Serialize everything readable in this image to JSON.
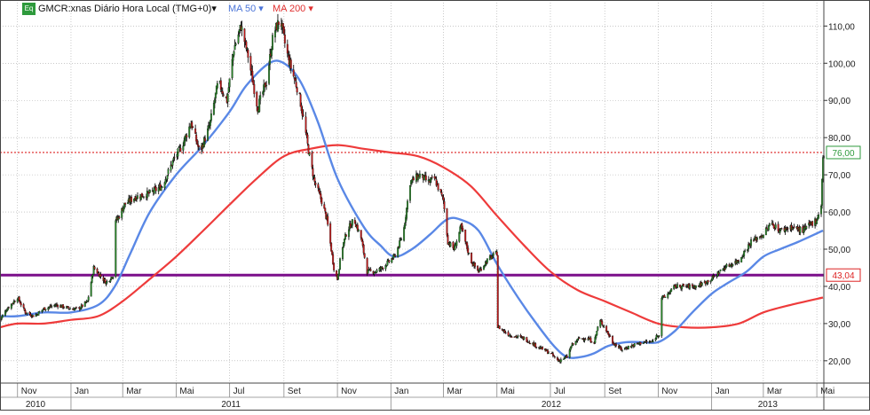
{
  "header": {
    "badge": "Eq",
    "symbol_label": "GMCR:xnas Diário Hora Local (TMG+0)",
    "ma50_label": "MA 50",
    "ma200_label": "MA 200",
    "dropdown_glyph": "▾"
  },
  "colors": {
    "price": "#111111",
    "up_candle": "#2a8a2a",
    "down_candle": "#c21a1a",
    "ma50": "#5a88e6",
    "ma200": "#ee3b3b",
    "support_line": "#7b0f8a",
    "dotted_line": "#dd2222",
    "grid": "#a8a8a8",
    "badge_green": "#2e9a3c",
    "badge_red": "#dd2222",
    "badge_purple": "#8a1a8a"
  },
  "chart_data": {
    "type": "candlestick",
    "y_axis": {
      "min": 14,
      "max": 117,
      "ticks": [
        20,
        30,
        40,
        50,
        60,
        70,
        80,
        90,
        100,
        110
      ],
      "tick_labels": [
        "20,00",
        "30,00",
        "40,00",
        "50,00",
        "60,00",
        "70,00",
        "80,00",
        "90,00",
        "100,00",
        "110,00"
      ]
    },
    "x_axis": {
      "range": [
        "2010-10-12",
        "2013-05-09"
      ],
      "month_ticks": [
        {
          "date": "2010-11-01",
          "label": "Nov"
        },
        {
          "date": "2011-01-01",
          "label": "Jan"
        },
        {
          "date": "2011-03-01",
          "label": "Mar"
        },
        {
          "date": "2011-05-01",
          "label": "Mai"
        },
        {
          "date": "2011-07-01",
          "label": "Jul"
        },
        {
          "date": "2011-09-01",
          "label": "Set"
        },
        {
          "date": "2011-11-01",
          "label": "Nov"
        },
        {
          "date": "2012-01-01",
          "label": "Jan"
        },
        {
          "date": "2012-03-01",
          "label": "Mar"
        },
        {
          "date": "2012-05-01",
          "label": "Mai"
        },
        {
          "date": "2012-07-01",
          "label": "Jul"
        },
        {
          "date": "2012-09-01",
          "label": "Set"
        },
        {
          "date": "2012-11-01",
          "label": "Nov"
        },
        {
          "date": "2013-01-01",
          "label": "Jan"
        },
        {
          "date": "2013-03-01",
          "label": "Mar"
        },
        {
          "date": "2013-05-01",
          "label": "Mai"
        }
      ],
      "year_labels": [
        {
          "label": "2010",
          "start": "2010-10-12",
          "end": "2011-01-01"
        },
        {
          "label": "2011",
          "start": "2011-01-01",
          "end": "2012-01-01"
        },
        {
          "label": "2012",
          "start": "2012-01-01",
          "end": "2013-01-01"
        },
        {
          "label": "2013",
          "start": "2013-01-01",
          "end": "2013-05-09"
        }
      ]
    },
    "price_path": [
      [
        "2010-10-12",
        31
      ],
      [
        "2010-10-20",
        34
      ],
      [
        "2010-11-01",
        37
      ],
      [
        "2010-11-10",
        33
      ],
      [
        "2010-11-20",
        32
      ],
      [
        "2010-12-01",
        34
      ],
      [
        "2010-12-15",
        35
      ],
      [
        "2011-01-01",
        34
      ],
      [
        "2011-01-10",
        34
      ],
      [
        "2011-01-20",
        36
      ],
      [
        "2011-01-27",
        45
      ],
      [
        "2011-02-03",
        43
      ],
      [
        "2011-02-10",
        41
      ],
      [
        "2011-02-18",
        43
      ],
      [
        "2011-02-23",
        58
      ],
      [
        "2011-03-03",
        62
      ],
      [
        "2011-03-15",
        64
      ],
      [
        "2011-04-01",
        65
      ],
      [
        "2011-04-15",
        67
      ],
      [
        "2011-04-28",
        74
      ],
      [
        "2011-05-08",
        78
      ],
      [
        "2011-05-18",
        84
      ],
      [
        "2011-05-28",
        76
      ],
      [
        "2011-06-08",
        83
      ],
      [
        "2011-06-18",
        95
      ],
      [
        "2011-06-28",
        90
      ],
      [
        "2011-07-06",
        104
      ],
      [
        "2011-07-14",
        110
      ],
      [
        "2011-07-22",
        102
      ],
      [
        "2011-08-02",
        88
      ],
      [
        "2011-08-12",
        95
      ],
      [
        "2011-08-20",
        108
      ],
      [
        "2011-08-28",
        112
      ],
      [
        "2011-09-03",
        104
      ],
      [
        "2011-09-10",
        98
      ],
      [
        "2011-09-18",
        92
      ],
      [
        "2011-09-24",
        84
      ],
      [
        "2011-09-30",
        75
      ],
      [
        "2011-10-06",
        68
      ],
      [
        "2011-10-14",
        63
      ],
      [
        "2011-10-20",
        58
      ],
      [
        "2011-10-28",
        45
      ],
      [
        "2011-11-01",
        42
      ],
      [
        "2011-11-06",
        50
      ],
      [
        "2011-11-12",
        55
      ],
      [
        "2011-11-20",
        58
      ],
      [
        "2011-11-28",
        53
      ],
      [
        "2011-12-05",
        44
      ],
      [
        "2011-12-15",
        44
      ],
      [
        "2011-12-22",
        45
      ],
      [
        "2012-01-05",
        48
      ],
      [
        "2012-01-15",
        54
      ],
      [
        "2012-01-23",
        68
      ],
      [
        "2012-02-03",
        70
      ],
      [
        "2012-02-13",
        68
      ],
      [
        "2012-02-20",
        69
      ],
      [
        "2012-03-01",
        63
      ],
      [
        "2012-03-06",
        52
      ],
      [
        "2012-03-13",
        50
      ],
      [
        "2012-03-21",
        56
      ],
      [
        "2012-04-01",
        47
      ],
      [
        "2012-04-10",
        44
      ],
      [
        "2012-04-20",
        47
      ],
      [
        "2012-05-01",
        49
      ],
      [
        "2012-05-03",
        29
      ],
      [
        "2012-05-15",
        27
      ],
      [
        "2012-06-01",
        26
      ],
      [
        "2012-06-15",
        24
      ],
      [
        "2012-07-01",
        22
      ],
      [
        "2012-07-10",
        20
      ],
      [
        "2012-07-20",
        21
      ],
      [
        "2012-07-25",
        24
      ],
      [
        "2012-08-03",
        26
      ],
      [
        "2012-08-12",
        26
      ],
      [
        "2012-08-20",
        25
      ],
      [
        "2012-08-26",
        31
      ],
      [
        "2012-09-01",
        29
      ],
      [
        "2012-09-10",
        25
      ],
      [
        "2012-09-20",
        23
      ],
      [
        "2012-10-01",
        24
      ],
      [
        "2012-10-15",
        25
      ],
      [
        "2012-10-25",
        25
      ],
      [
        "2012-10-31",
        27
      ],
      [
        "2012-11-08",
        37
      ],
      [
        "2012-11-20",
        40
      ],
      [
        "2012-12-01",
        40
      ],
      [
        "2012-12-15",
        40
      ],
      [
        "2013-01-01",
        42
      ],
      [
        "2013-01-15",
        45
      ],
      [
        "2013-02-01",
        47
      ],
      [
        "2013-02-15",
        52
      ],
      [
        "2013-03-01",
        54
      ],
      [
        "2013-03-10",
        57
      ],
      [
        "2013-03-20",
        55
      ],
      [
        "2013-04-01",
        56
      ],
      [
        "2013-04-15",
        55
      ],
      [
        "2013-05-01",
        58
      ],
      [
        "2013-05-06",
        62
      ],
      [
        "2013-05-08",
        75
      ]
    ],
    "gaps": [
      "2011-02-21",
      "2012-05-02",
      "2012-11-05"
    ],
    "series": [
      {
        "name": "MA 50",
        "points": [
          [
            "2010-10-12",
            32
          ],
          [
            "2010-11-01",
            32
          ],
          [
            "2010-12-01",
            33
          ],
          [
            "2011-01-01",
            33
          ],
          [
            "2011-02-01",
            35
          ],
          [
            "2011-02-20",
            40
          ],
          [
            "2011-03-10",
            49
          ],
          [
            "2011-04-01",
            60
          ],
          [
            "2011-05-01",
            70
          ],
          [
            "2011-06-01",
            78
          ],
          [
            "2011-07-01",
            87
          ],
          [
            "2011-07-20",
            94
          ],
          [
            "2011-08-15",
            100
          ],
          [
            "2011-09-01",
            100
          ],
          [
            "2011-09-20",
            95
          ],
          [
            "2011-10-10",
            84
          ],
          [
            "2011-11-01",
            69
          ],
          [
            "2011-12-01",
            56
          ],
          [
            "2011-12-20",
            51
          ],
          [
            "2012-01-05",
            48
          ],
          [
            "2012-01-25",
            50
          ],
          [
            "2012-02-15",
            54
          ],
          [
            "2012-03-05",
            58
          ],
          [
            "2012-03-20",
            58
          ],
          [
            "2012-04-10",
            55
          ],
          [
            "2012-05-01",
            46
          ],
          [
            "2012-05-25",
            37
          ],
          [
            "2012-06-15",
            30
          ],
          [
            "2012-07-05",
            24
          ],
          [
            "2012-07-20",
            21
          ],
          [
            "2012-08-05",
            21
          ],
          [
            "2012-08-20",
            22
          ],
          [
            "2012-09-05",
            24
          ],
          [
            "2012-09-25",
            25
          ],
          [
            "2012-10-15",
            25
          ],
          [
            "2012-11-01",
            25
          ],
          [
            "2012-11-20",
            28
          ],
          [
            "2012-12-10",
            33
          ],
          [
            "2013-01-01",
            38
          ],
          [
            "2013-01-20",
            41
          ],
          [
            "2013-02-10",
            44
          ],
          [
            "2013-03-01",
            48
          ],
          [
            "2013-03-20",
            50
          ],
          [
            "2013-04-10",
            52
          ],
          [
            "2013-05-08",
            55
          ]
        ]
      },
      {
        "name": "MA 200",
        "points": [
          [
            "2010-10-12",
            29
          ],
          [
            "2010-11-01",
            30
          ],
          [
            "2010-12-01",
            30
          ],
          [
            "2011-01-01",
            31
          ],
          [
            "2011-02-01",
            32
          ],
          [
            "2011-03-01",
            36
          ],
          [
            "2011-04-01",
            42
          ],
          [
            "2011-05-01",
            48
          ],
          [
            "2011-06-01",
            55
          ],
          [
            "2011-07-01",
            62
          ],
          [
            "2011-08-01",
            69
          ],
          [
            "2011-09-01",
            75
          ],
          [
            "2011-10-01",
            77
          ],
          [
            "2011-11-01",
            78
          ],
          [
            "2011-12-01",
            77
          ],
          [
            "2012-01-01",
            76
          ],
          [
            "2012-02-01",
            75
          ],
          [
            "2012-03-01",
            72
          ],
          [
            "2012-04-01",
            67
          ],
          [
            "2012-05-01",
            59
          ],
          [
            "2012-06-01",
            51
          ],
          [
            "2012-07-01",
            44
          ],
          [
            "2012-08-01",
            39
          ],
          [
            "2012-09-01",
            36
          ],
          [
            "2012-10-01",
            33
          ],
          [
            "2012-11-01",
            30
          ],
          [
            "2012-12-01",
            29
          ],
          [
            "2013-01-01",
            29
          ],
          [
            "2013-02-01",
            30
          ],
          [
            "2013-03-01",
            33
          ],
          [
            "2013-04-01",
            35
          ],
          [
            "2013-05-08",
            37
          ]
        ]
      }
    ],
    "horizontal_lines": [
      {
        "value": 43.04,
        "label": "43,04",
        "style": "solid"
      },
      {
        "value": 76.0,
        "label": "76,00",
        "style": "dotted"
      }
    ]
  }
}
